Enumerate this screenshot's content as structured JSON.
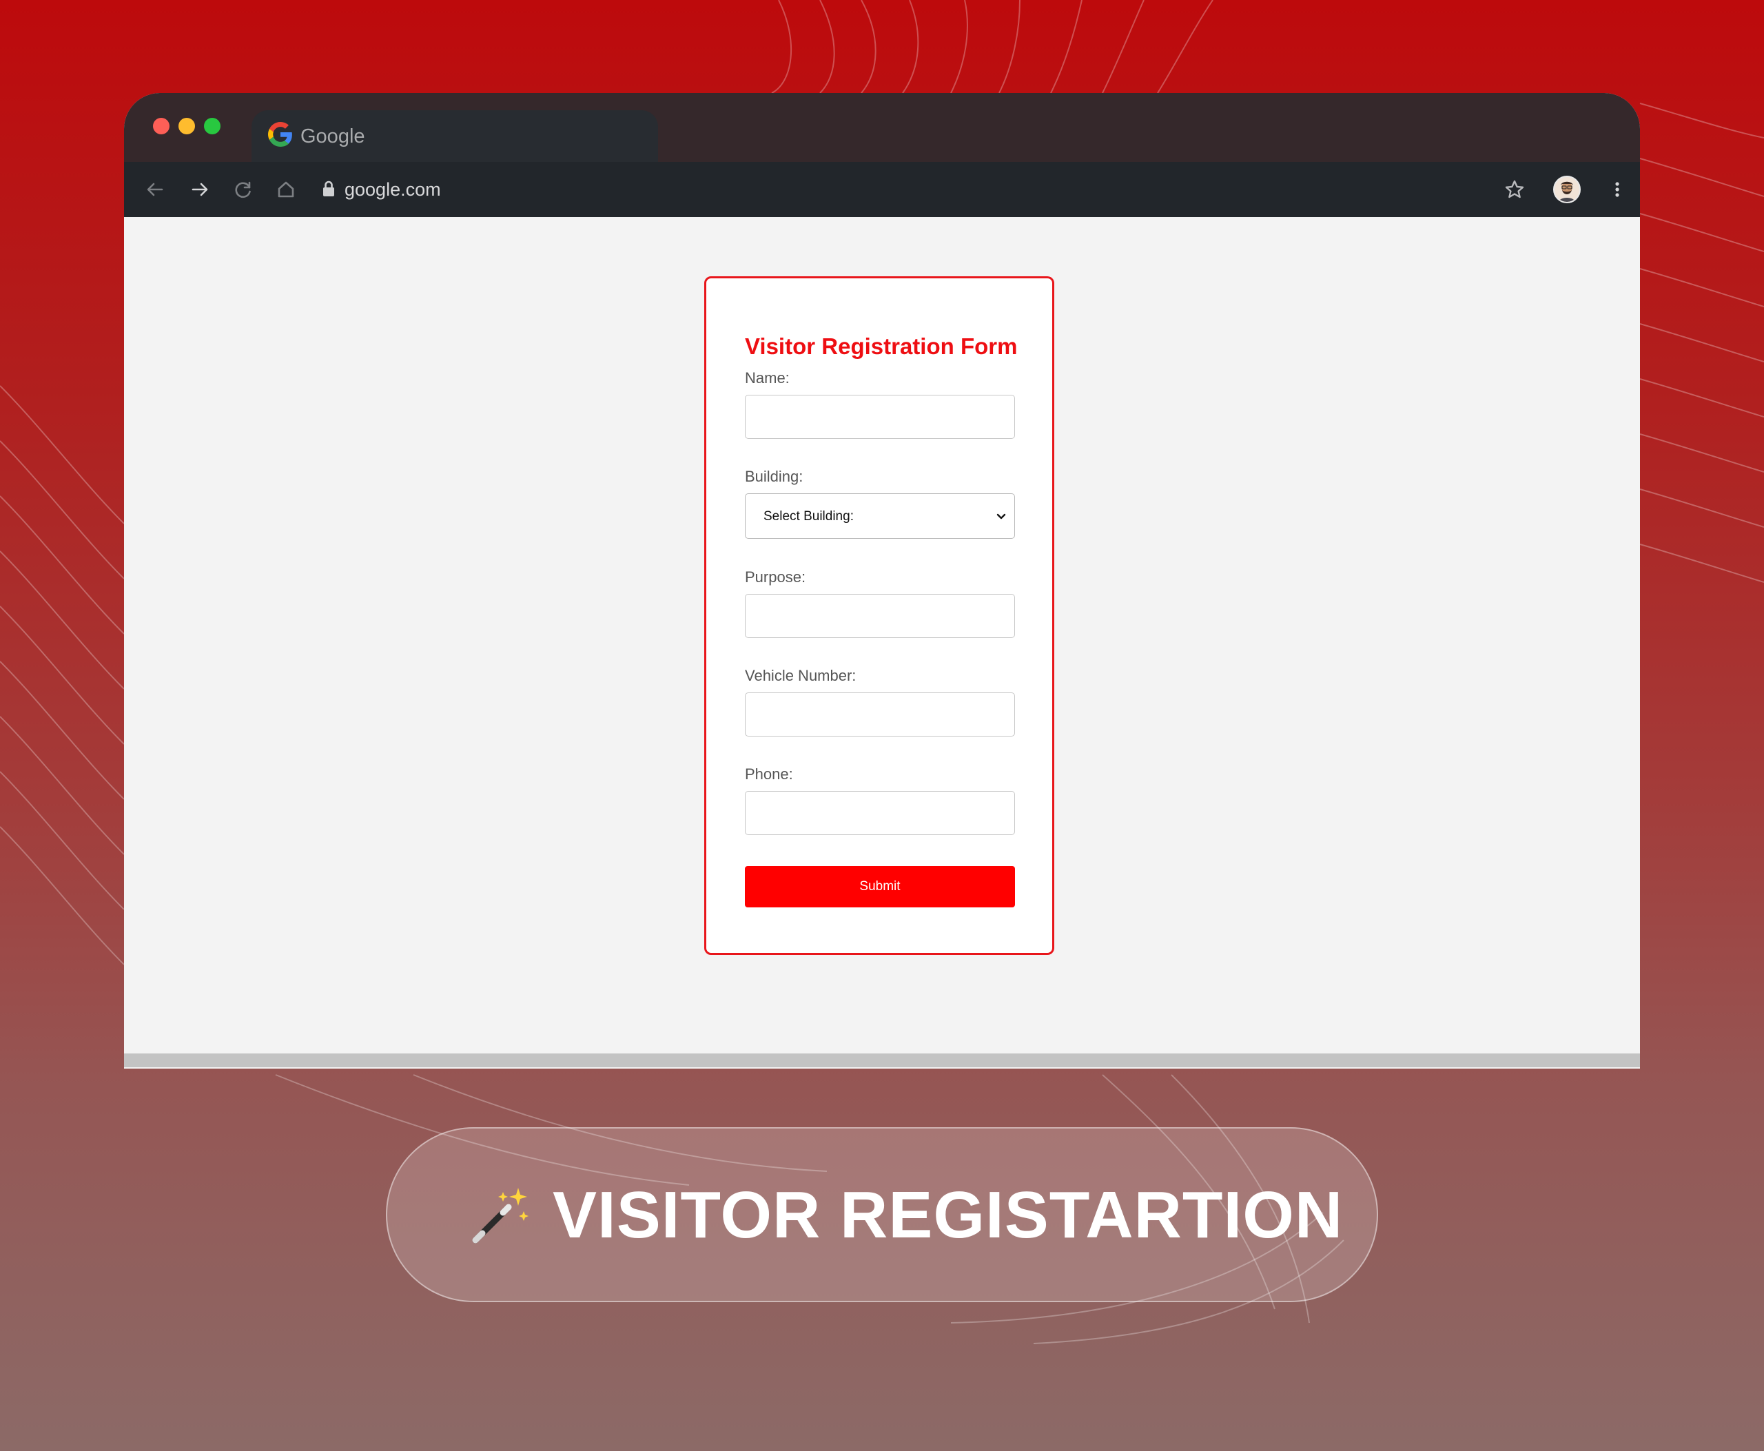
{
  "browser": {
    "tab_title": "Google",
    "url": "google.com"
  },
  "form": {
    "title": "Visitor Registration Form",
    "fields": [
      {
        "label": "Name:",
        "value": ""
      },
      {
        "label": "Building:",
        "selected": "Select Building:"
      },
      {
        "label": "Purpose:",
        "value": ""
      },
      {
        "label": "Vehicle Number:",
        "value": ""
      },
      {
        "label": "Phone:",
        "value": ""
      }
    ],
    "submit_label": "Submit"
  },
  "banner": {
    "text": "VISITOR REGISTARTION",
    "icon": "magic-wand-icon"
  },
  "colors": {
    "accent": "#ff0000",
    "title": "#ee0e12",
    "card_border": "#e8161b",
    "titlebar": "#35282b",
    "toolbar": "#22262b"
  }
}
